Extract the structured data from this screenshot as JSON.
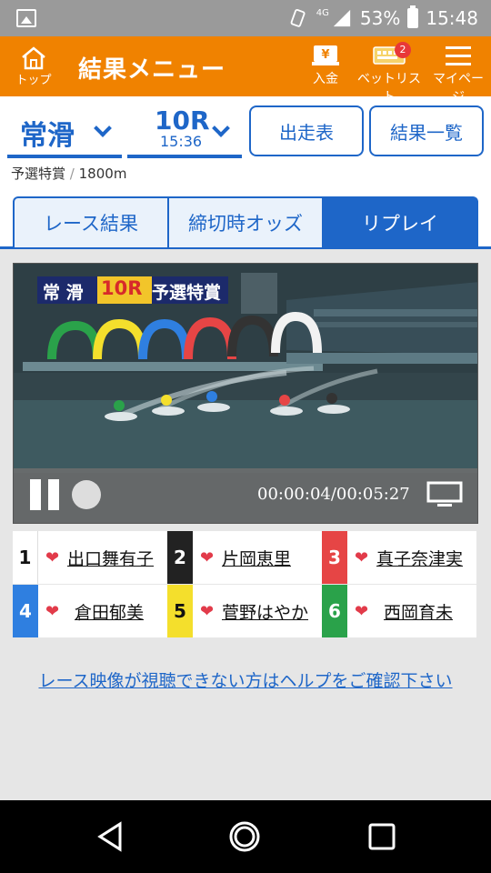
{
  "status_bar": {
    "network": "4G",
    "battery": "53%",
    "time": "15:48"
  },
  "header": {
    "top_label": "トップ",
    "title": "結果メニュー",
    "deposit_label": "入金",
    "bet_list_label": "ベットリスト",
    "bet_list_badge": "2",
    "mypage_label": "マイページ",
    "color": "#f08200"
  },
  "selector": {
    "place": "常滑",
    "race_number": "10R",
    "race_time": "15:36",
    "entry_list_button": "出走表",
    "results_list_button": "結果一覧"
  },
  "race_info": {
    "race_name": "予選特賞",
    "separator": "/",
    "distance": "1800m"
  },
  "tabs": [
    {
      "label": "レース結果",
      "active": false
    },
    {
      "label": "締切時オッズ",
      "active": false
    },
    {
      "label": "リプレイ",
      "active": true
    }
  ],
  "video": {
    "overlay_place": "常 滑",
    "overlay_race": "10R",
    "overlay_title": "予選特賞",
    "time_display": "00:00:04/00:05:27",
    "progress": 0.012
  },
  "racers": [
    {
      "lane": "1",
      "name": "出口舞有子",
      "color": "#ffffff"
    },
    {
      "lane": "2",
      "name": "片岡恵里",
      "color": "#222222"
    },
    {
      "lane": "3",
      "name": "真子奈津実",
      "color": "#e64545"
    },
    {
      "lane": "4",
      "name": "倉田郁美",
      "color": "#2f7fe0"
    },
    {
      "lane": "5",
      "name": "菅野はやか",
      "color": "#f4df2c"
    },
    {
      "lane": "6",
      "name": "西岡育未",
      "color": "#2aa24a"
    }
  ],
  "help_link": "レース映像が視聴できない方はヘルプをご確認下さい",
  "accent_color": "#1e66c8"
}
